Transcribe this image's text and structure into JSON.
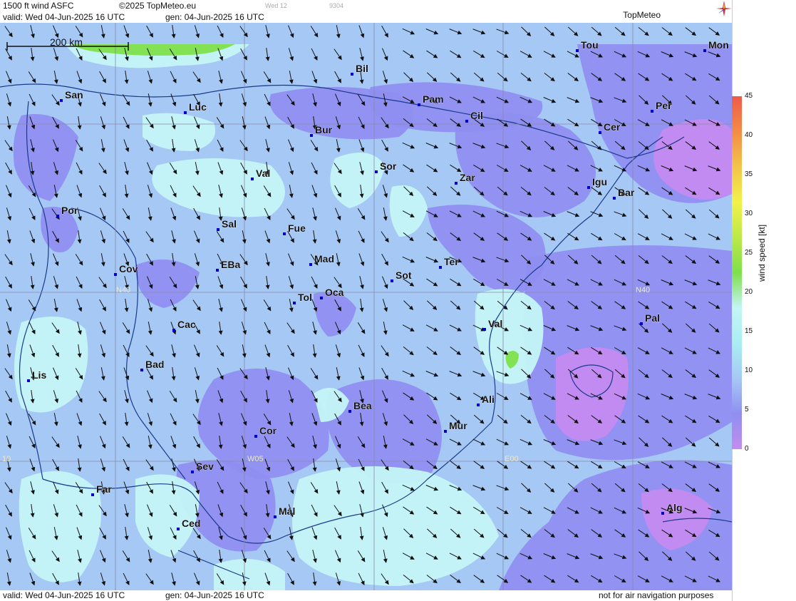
{
  "header": {
    "product": "1500 ft wind ASFC",
    "copyright": "©2025 TopMeteo.eu",
    "run_small": "Wed 12",
    "code_small": "9304",
    "valid": "valid:  Wed  04-Jun-2025  16 UTC",
    "gen": "gen: 04-Jun-2025 16 UTC",
    "brand": "TopMeteo"
  },
  "footer": {
    "valid": "valid:  Wed  04-Jun-2025  16 UTC",
    "gen": "gen: 04-Jun-2025 16 UTC",
    "disclaimer": "not for air navigation purposes"
  },
  "scale_bar": {
    "label": "200 km"
  },
  "grid_labels": {
    "lat_w": "N40",
    "lat_e": "N40",
    "lon_w05": "W05",
    "lon_e00": "E00",
    "lon_w10": "10"
  },
  "legend": {
    "title": "wind speed [kt]",
    "ticks": [
      "45",
      "40",
      "35",
      "30",
      "25",
      "20",
      "15",
      "10",
      "5",
      "0"
    ],
    "colors": [
      "#f05a4a",
      "#f28c46",
      "#f2c44a",
      "#f2f24a",
      "#bde84a",
      "#7ee04a",
      "#c4f5f5",
      "#a8eef2",
      "#a6c8f5",
      "#8f8ff0",
      "#c58bf0"
    ]
  },
  "cities": [
    "Bil",
    "Tou",
    "Mon",
    "San",
    "Luc",
    "Pam",
    "Cil",
    "Per",
    "Bur",
    "Cer",
    "Sor",
    "Zar",
    "Val",
    "Igu",
    "Bar",
    "Por",
    "Sal",
    "Fue",
    "Mad",
    "EBa",
    "Cov",
    "Ter",
    "Sot",
    "Tol",
    "Oca",
    "Pal",
    "Val",
    "Cac",
    "Bad",
    "Lis",
    "Ali",
    "Bea",
    "Mur",
    "Cor",
    "Sev",
    "Far",
    "Mál",
    "Ced",
    "Alg"
  ],
  "colors": {
    "base": "#a6c8f5",
    "calm": "#8f8ff0",
    "very_calm": "#c58bf0",
    "moderate": "#c4f5f5",
    "strong": "#7ee04a",
    "border": "#1a3a8a",
    "grid": "#8a8aaa",
    "arrow": "#111111"
  }
}
